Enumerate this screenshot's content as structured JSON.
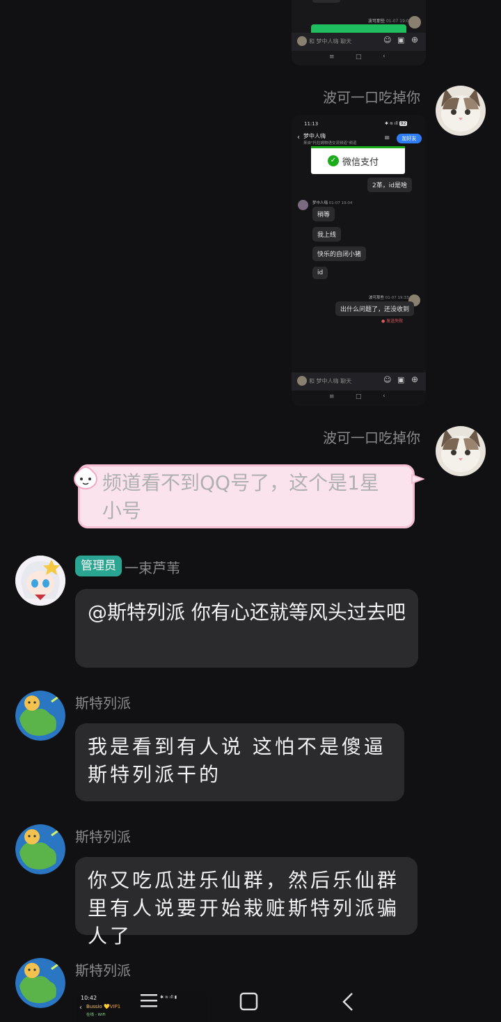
{
  "shot1": {
    "sender": "波可那些",
    "time": "01-07 19:02",
    "input_placeholder": "和 梦中人嗨 聊天"
  },
  "shot2": {
    "status_time": "11:13",
    "status_battery": "92",
    "channel_name": "梦中人嗨",
    "channel_sub": "来自\"托拉姆物语交流频道\"频道",
    "add_friend": "加好友",
    "wechat_pay": "微信支付",
    "my_msg1": "2革，id是啥",
    "other_name": "梦中人嗨",
    "other_time": "01-07 19:04",
    "other_msgs": [
      "稍等",
      "我上线",
      "快乐的自闭小猪",
      "id"
    ],
    "me_name": "波可那些",
    "me_time": "01-07 19:33",
    "my_msg2": "出什么问题了，还没收到",
    "fail": "发送失败",
    "input_placeholder": "和 梦中人嗨 聊天"
  },
  "messages": {
    "m1_sender": "波可一口吃掉你",
    "m2_sender": "波可一口吃掉你",
    "m2_text": "频道看不到QQ号了，这个是1星小号",
    "m3_badge": "管理员",
    "m3_sender": "一束芦苇",
    "m3_text": "@斯特列派 你有心还就等风头过去吧",
    "m4_sender": "斯特列派",
    "m4_text": "我是看到有人说 这怕不是傻逼斯特列派干的",
    "m5_sender": "斯特列派",
    "m5_text": "你又吃瓜进乐仙群，然后乐仙群里有人说要开始栽赃斯特列派骗人了",
    "m6_sender": "斯特列派",
    "m6_preview_time": "10:42",
    "m6_preview_name": "Bussio",
    "m6_preview_badge": "💛VIP1",
    "m6_preview_status": "在线 - WiFi"
  }
}
